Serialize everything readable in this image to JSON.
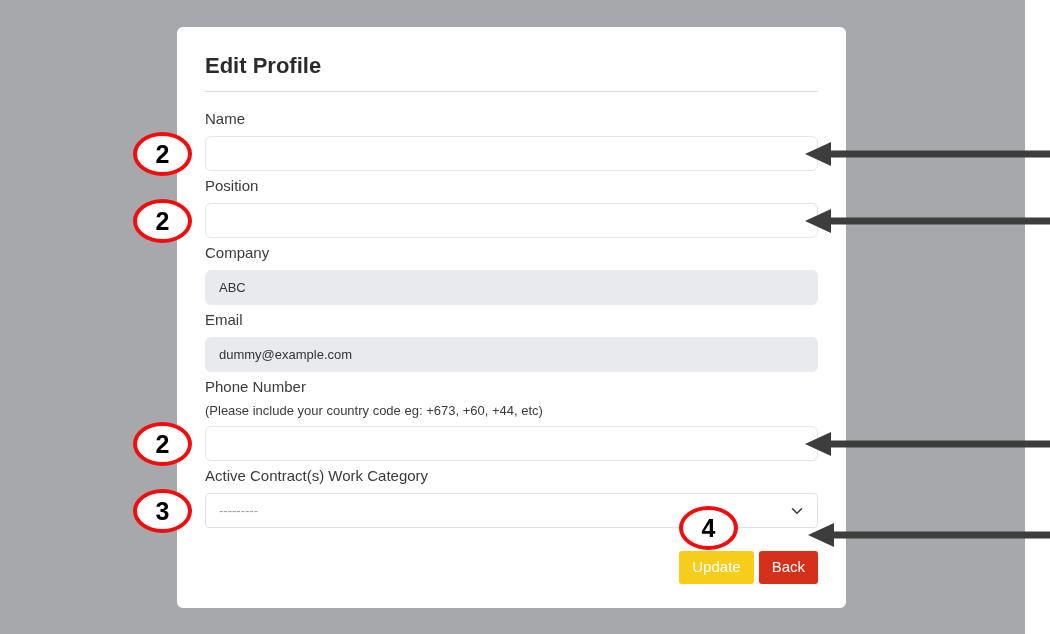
{
  "form": {
    "title": "Edit Profile",
    "fields": [
      {
        "kind": "input",
        "label": "Name",
        "disabled": false,
        "callout": "2",
        "arrow": true
      },
      {
        "kind": "input",
        "label": "Position",
        "disabled": false,
        "callout": "2",
        "arrow": true
      },
      {
        "kind": "input",
        "label": "Company",
        "value": "ABC",
        "disabled": true
      },
      {
        "kind": "input",
        "label": "Email",
        "value": "dummy@example.com",
        "disabled": true
      },
      {
        "kind": "input",
        "label": "Phone Number",
        "note": "(Please include your country code eg: +673, +60, +44, etc)",
        "disabled": false,
        "callout": "2",
        "arrow": true
      },
      {
        "kind": "select",
        "label": "Active Contract(s) Work Category",
        "placeholder": "---------",
        "disabled": false,
        "callout": "3",
        "arrow": false
      }
    ],
    "buttons": [
      {
        "kind": "update",
        "label": "Update",
        "callout": "4",
        "arrow": true
      },
      {
        "kind": "back",
        "label": "Back"
      }
    ]
  }
}
